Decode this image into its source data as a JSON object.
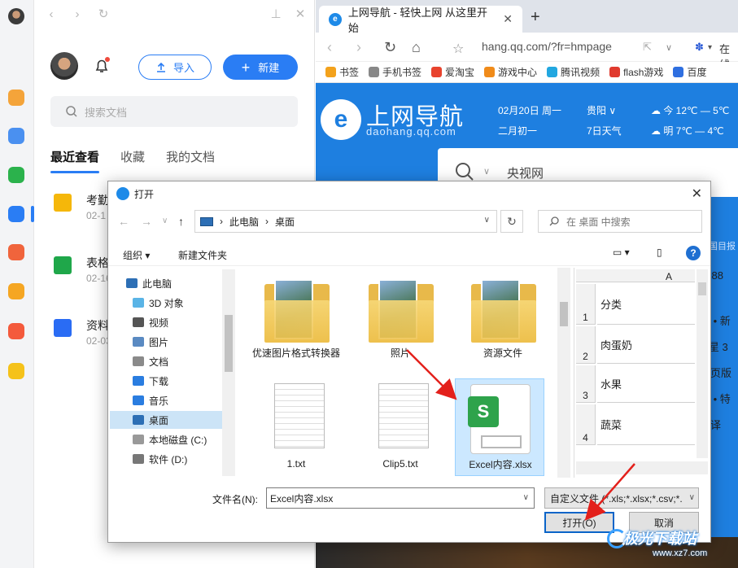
{
  "docs_panel": {
    "import_label": "导入",
    "new_label": "新建",
    "search_placeholder": "搜索文档",
    "tabs": [
      "最近查看",
      "收藏",
      "我的文档"
    ],
    "items": [
      {
        "title": "考勤",
        "date": "02-1",
        "color": "#f5b70a"
      },
      {
        "title": "表格",
        "date": "02-16",
        "color": "#1fa74a"
      },
      {
        "title": "资料",
        "date": "02-03",
        "color": "#2a6cf4"
      }
    ]
  },
  "rail_icons": [
    {
      "name": "star-app-icon",
      "color": "#f4a43a"
    },
    {
      "name": "clock-app-icon",
      "color": "#4a90f0"
    },
    {
      "name": "wechat-app-icon",
      "color": "#2bb24c"
    },
    {
      "name": "docs-app-icon",
      "color": "#2a7df4"
    },
    {
      "name": "pdf-app-icon",
      "color": "#f0643c"
    },
    {
      "name": "search-app-icon",
      "color": "#f5a623"
    },
    {
      "name": "image-app-icon",
      "color": "#f45a3c"
    },
    {
      "name": "music-app-icon",
      "color": "#f5c21a"
    }
  ],
  "browser": {
    "tab_title": "上网导航 - 轻快上网 从这里开始",
    "url": "hang.qq.com/?fr=hmpage",
    "search_hint": "在线",
    "bookmarks": [
      {
        "label": "书签",
        "color": "#f3a21c"
      },
      {
        "label": "手机书签",
        "color": "#888888"
      },
      {
        "label": "爱淘宝",
        "color": "#e8432e"
      },
      {
        "label": "游戏中心",
        "color": "#f08b1a"
      },
      {
        "label": "腾讯视频",
        "color": "#22a7e0"
      },
      {
        "label": "flash游戏",
        "color": "#e03a2e"
      },
      {
        "label": "百度",
        "color": "#2f6fe0"
      }
    ],
    "hero_title": "上网导航",
    "hero_sub": "daohang.qq.com",
    "date": "02月20日 周一",
    "lunar": "二月初一",
    "city": "贵阳",
    "forecast": "7日天气",
    "today": "今 12℃ — 5℃",
    "tomorrow": "明 7℃ — 4℃",
    "search_text": "央视网",
    "right_fragments": [
      "中国目报",
      "1688",
      "狐 • 新",
      "1 星 3",
      "网页版",
      "网 • 特",
      "翻译"
    ]
  },
  "dialog": {
    "title": "打开",
    "path": [
      "此电脑",
      "桌面"
    ],
    "search_placeholder": "在 桌面 中搜索",
    "organize": "组织",
    "new_folder": "新建文件夹",
    "tree": [
      {
        "label": "此电脑",
        "icon": "pc-icon",
        "indent": 0
      },
      {
        "label": "3D 对象",
        "icon": "3d-objects-icon",
        "indent": 1
      },
      {
        "label": "视频",
        "icon": "video-folder-icon",
        "indent": 1
      },
      {
        "label": "图片",
        "icon": "pictures-folder-icon",
        "indent": 1
      },
      {
        "label": "文档",
        "icon": "documents-folder-icon",
        "indent": 1
      },
      {
        "label": "下载",
        "icon": "download-folder-icon",
        "indent": 1
      },
      {
        "label": "音乐",
        "icon": "music-folder-icon",
        "indent": 1
      },
      {
        "label": "桌面",
        "icon": "desktop-folder-icon",
        "indent": 1,
        "selected": true
      },
      {
        "label": "本地磁盘 (C:)",
        "icon": "drive-c-icon",
        "indent": 1
      },
      {
        "label": "软件 (D:)",
        "icon": "drive-d-icon",
        "indent": 1
      }
    ],
    "files": [
      {
        "label": "优速图片格式转换器",
        "type": "folder"
      },
      {
        "label": "照片",
        "type": "folder"
      },
      {
        "label": "资源文件",
        "type": "folder"
      },
      {
        "label": "1.txt",
        "type": "txt"
      },
      {
        "label": "Clip5.txt",
        "type": "txt"
      },
      {
        "label": "Excel内容.xlsx",
        "type": "xlsx",
        "selected": true
      }
    ],
    "preview": {
      "column": "A",
      "rows": [
        {
          "n": "1",
          "v": "分类"
        },
        {
          "n": "2",
          "v": "肉蛋奶"
        },
        {
          "n": "3",
          "v": "水果"
        },
        {
          "n": "4",
          "v": "蔬菜"
        }
      ]
    },
    "filename_label": "文件名(N):",
    "filename_value": "Excel内容.xlsx",
    "filetype": "自定义文件 (*.xls;*.xlsx;*.csv;*.",
    "open_label": "打开(O)",
    "cancel_label": "取消"
  },
  "watermark": {
    "line1": "极光下载站",
    "line2": "www.xz7.com"
  }
}
